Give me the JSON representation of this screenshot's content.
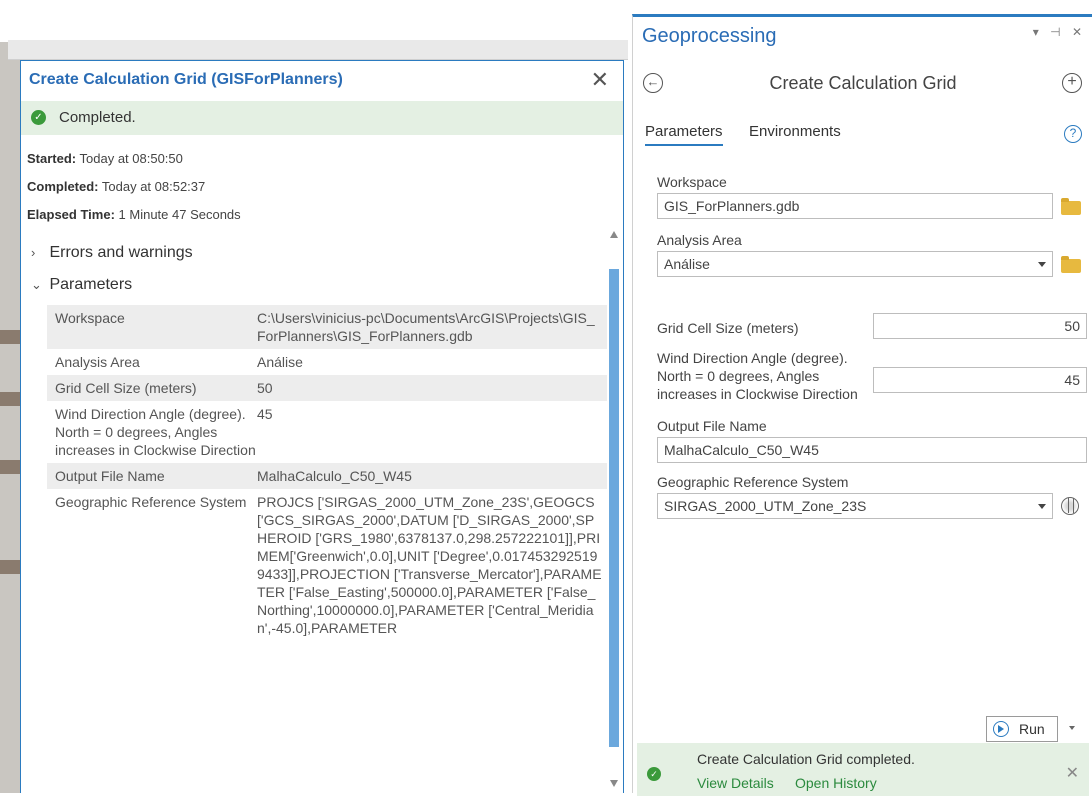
{
  "details": {
    "title": "Create Calculation Grid (GISForPlanners)",
    "close_glyph": "✕",
    "status": "Completed.",
    "started_label": "Started:",
    "started_value": "Today at 08:50:50",
    "completed_label": "Completed:",
    "completed_value": "Today at 08:52:37",
    "elapsed_label": "Elapsed Time:",
    "elapsed_value": "1 Minute 47 Seconds",
    "errors_section": "Errors and warnings",
    "parameters_section": "Parameters",
    "params": [
      {
        "label": "Workspace",
        "value": "C:\\Users\\vinicius-pc\\Documents\\ArcGIS\\Projects\\GIS_ForPlanners\\GIS_ForPlanners.gdb"
      },
      {
        "label": "Analysis Area",
        "value": "Análise"
      },
      {
        "label": "Grid Cell Size (meters)",
        "value": "50"
      },
      {
        "label": "Wind Direction Angle (degree). North = 0 degrees, Angles increases in Clockwise Direction",
        "value": "45"
      },
      {
        "label": "Output File Name",
        "value": "MalhaCalculo_C50_W45"
      },
      {
        "label": "Geographic Reference System",
        "value": "PROJCS ['SIRGAS_2000_UTM_Zone_23S',GEOGCS ['GCS_SIRGAS_2000',DATUM ['D_SIRGAS_2000',SPHEROID ['GRS_1980',6378137.0,298.257222101]],PRIMEM['Greenwich',0.0],UNIT ['Degree',0.0174532925199433]],PROJECTION ['Transverse_Mercator'],PARAMETER ['False_Easting',500000.0],PARAMETER ['False_Northing',10000000.0],PARAMETER ['Central_Meridian',-45.0],PARAMETER"
      }
    ]
  },
  "geoprocessing": {
    "pane_title": "Geoprocessing",
    "window_controls": "▾ ⊣ ✕",
    "tool_title": "Create Calculation Grid",
    "tabs": [
      "Parameters",
      "Environments"
    ],
    "help_glyph": "?",
    "fields": {
      "workspace_label": "Workspace",
      "workspace_value": "GIS_ForPlanners.gdb",
      "analysis_area_label": "Analysis Area",
      "analysis_area_value": "Análise",
      "grid_cell_label": "Grid Cell Size (meters)",
      "grid_cell_value": "50",
      "wind_label": "Wind Direction Angle (degree). North = 0 degrees, Angles increases in Clockwise Direction",
      "wind_value": "45",
      "output_label": "Output File Name",
      "output_value": "MalhaCalculo_C50_W45",
      "grs_label": "Geographic Reference System",
      "grs_value": "SIRGAS_2000_UTM_Zone_23S"
    },
    "run_label": "Run",
    "status": {
      "message": "Create Calculation Grid completed.",
      "view_details": "View Details",
      "open_history": "Open History",
      "close_glyph": "✕"
    }
  },
  "icons": [
    "check-icon",
    "close-icon",
    "chevron-right-icon",
    "chevron-down-icon",
    "back-icon",
    "add-icon",
    "help-icon",
    "folder-icon",
    "globe-icon",
    "play-icon",
    "dropdown-arrow-icon"
  ],
  "colors": {
    "accent": "#2b7bc0",
    "success": "#3b9a3b",
    "success_bg": "#e4f0e3",
    "link_green": "#2b8a3e"
  }
}
